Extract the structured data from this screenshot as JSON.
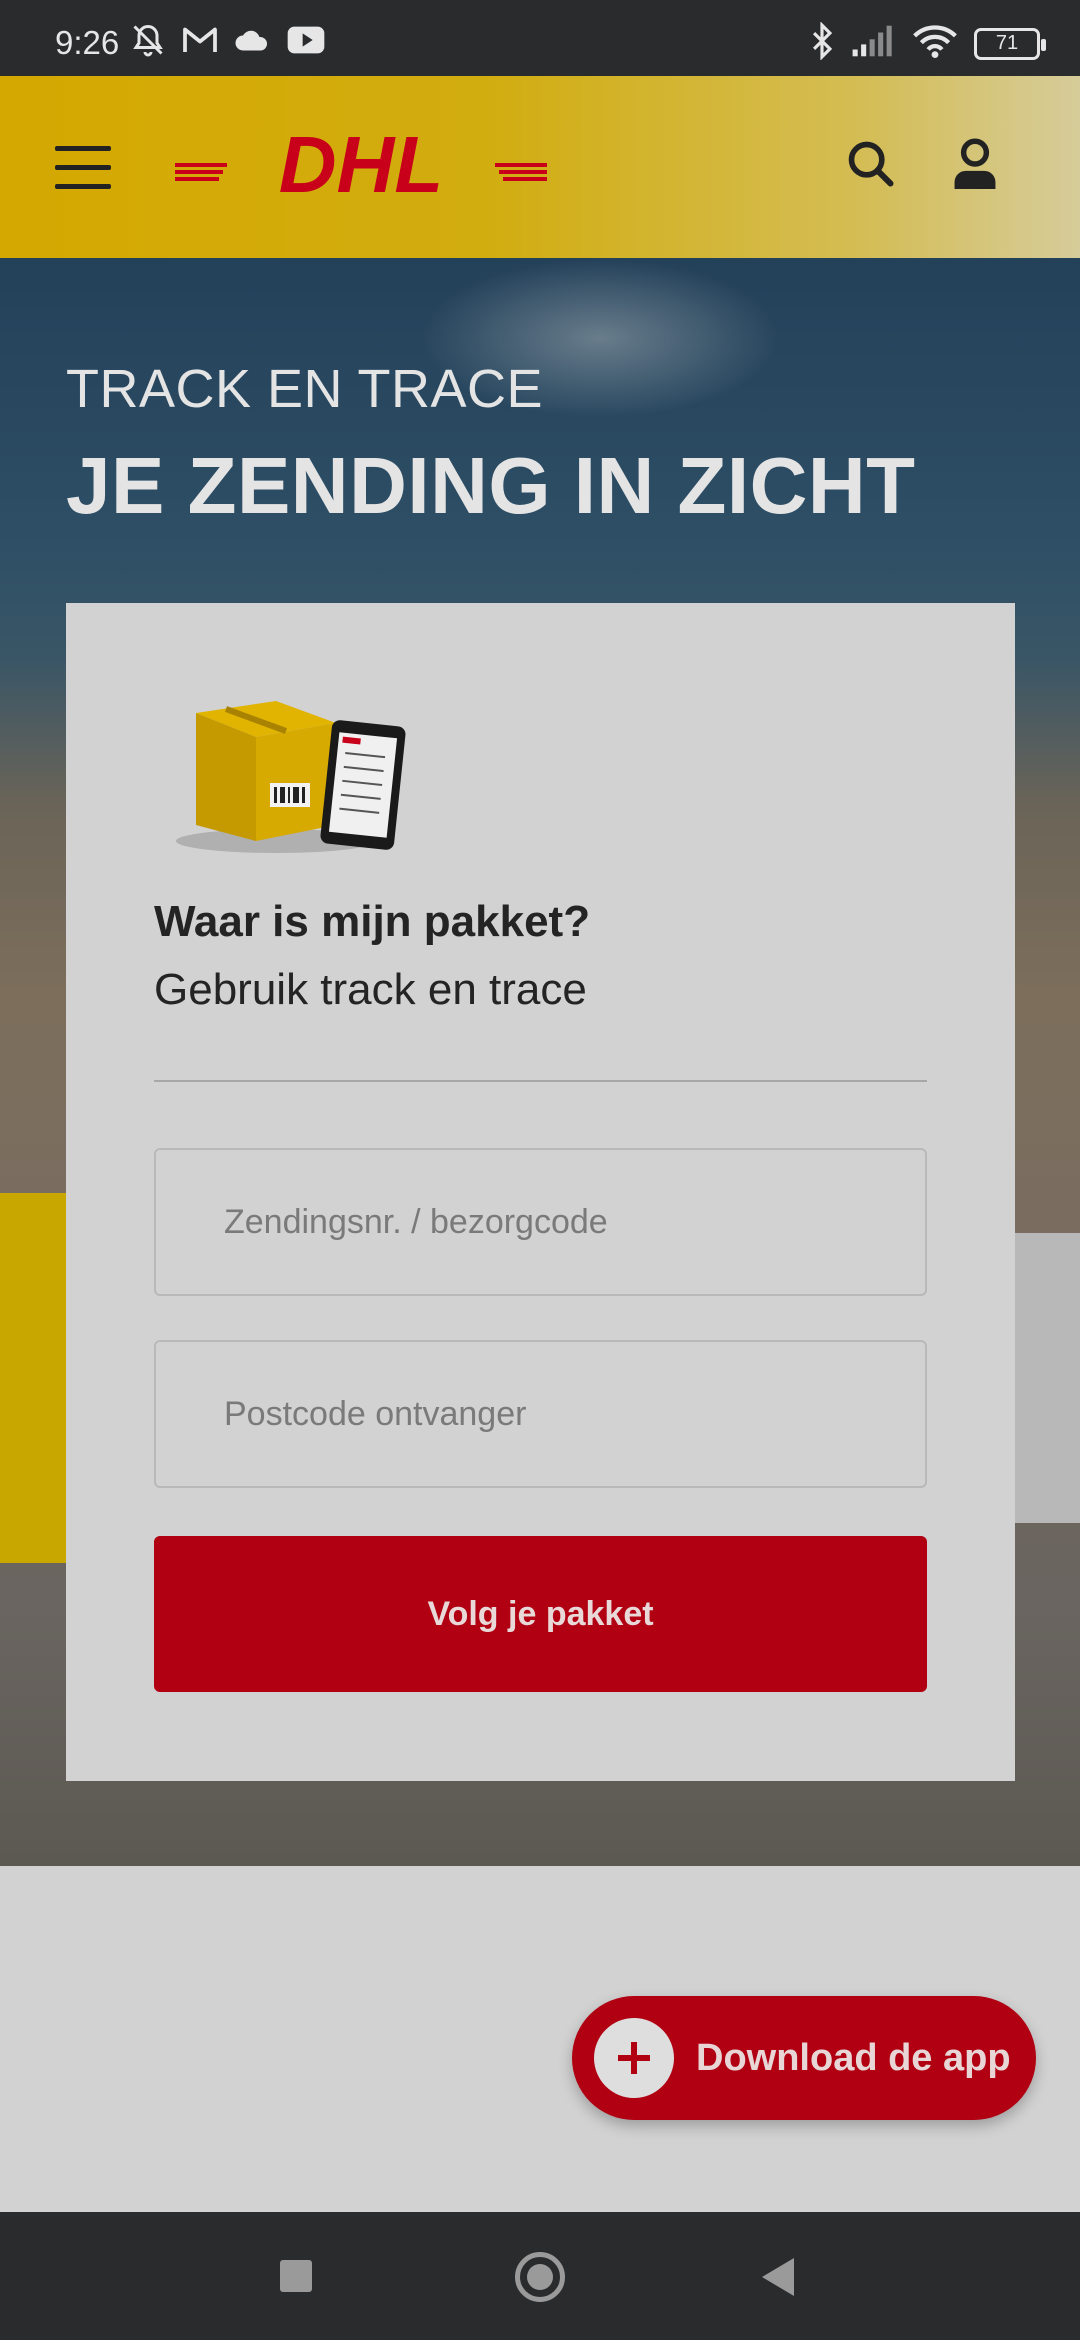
{
  "status_bar": {
    "time": "9:26",
    "battery": "71"
  },
  "header": {
    "logo_text": "DHL",
    "brand_colors": {
      "yellow": "#d4a800",
      "red": "#b00012"
    }
  },
  "hero": {
    "kicker": "TRACK EN TRACE",
    "title": "JE ZENDING IN ZICHT"
  },
  "tracking_card": {
    "heading": "Waar is mijn pakket?",
    "subheading": "Gebruik track en trace",
    "shipment_field": {
      "placeholder": "Zendingsnr. / bezorgcode",
      "value": ""
    },
    "postcode_field": {
      "placeholder": "Postcode ontvanger",
      "value": ""
    },
    "submit_label": "Volg je pakket"
  },
  "download_app": {
    "label": "Download de app"
  },
  "icons": [
    "muted-bell-icon",
    "gmail-icon",
    "cloud-icon",
    "youtube-icon",
    "bluetooth-icon",
    "signal-icon",
    "wifi-icon",
    "battery-icon",
    "menu-icon",
    "search-icon",
    "user-icon",
    "plus-icon",
    "recents-icon",
    "home-icon",
    "back-icon"
  ]
}
